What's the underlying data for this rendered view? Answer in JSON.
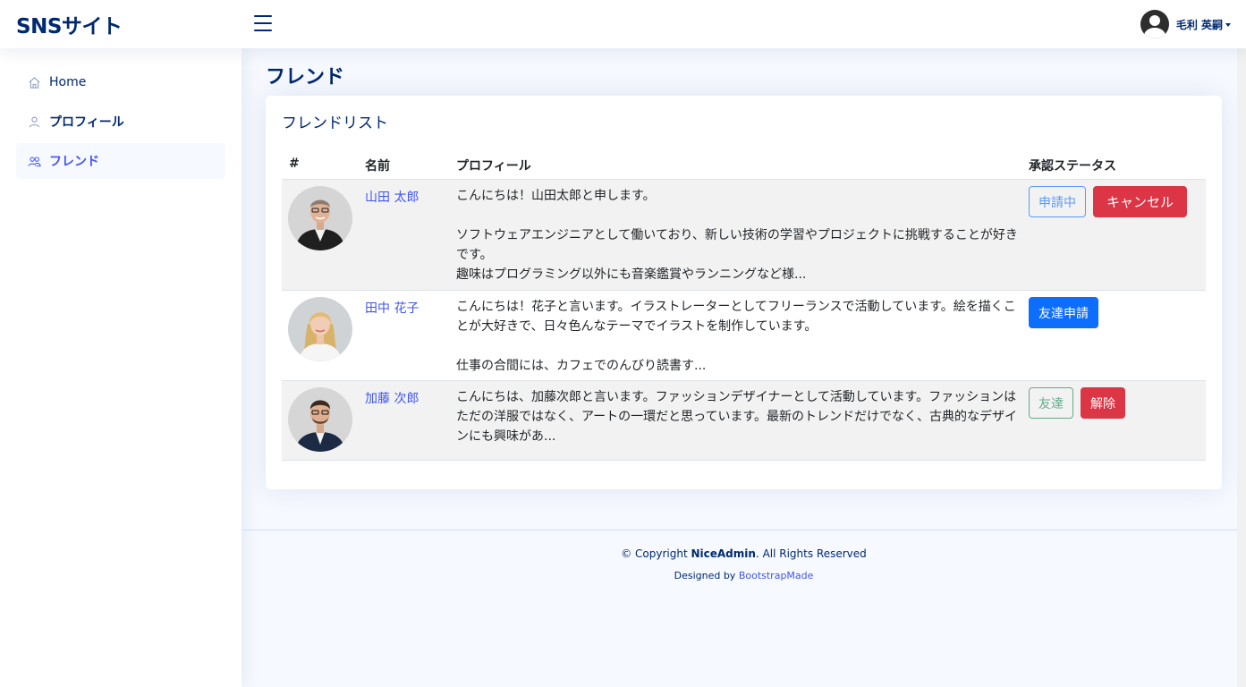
{
  "header": {
    "logo": "SNSサイト",
    "user_name": "毛利 英嗣"
  },
  "sidebar": {
    "items": [
      {
        "label": "Home",
        "icon": "house-icon"
      },
      {
        "label": "プロフィール",
        "icon": "person-icon"
      },
      {
        "label": "フレンド",
        "icon": "people-icon"
      }
    ]
  },
  "main": {
    "page_title": "フレンド",
    "card_title": "フレンドリスト",
    "columns": [
      "#",
      "名前",
      "プロフィール",
      "承認ステータス"
    ],
    "rows": [
      {
        "name": "山田 太郎",
        "profile": "こんにちは！山田太郎と申します。\n\nソフトウェアエンジニアとして働いており、新しい技術の学習やプロジェクトに挑戦することが好きです。\n趣味はプログラミング以外にも音楽鑑賞やランニングなど様...",
        "actions": [
          "申請中",
          "キャンセル"
        ]
      },
      {
        "name": "田中 花子",
        "profile": "こんにちは！花子と言います。イラストレーターとしてフリーランスで活動しています。絵を描くことが大好きで、日々色んなテーマでイラストを制作しています。\n\n仕事の合間には、カフェでのんびり読書す...",
        "actions": [
          "友達申請"
        ]
      },
      {
        "name": "加藤 次郎",
        "profile": "こんにちは、加藤次郎と言います。ファッションデザイナーとして活動しています。ファッションはただの洋服ではなく、アートの一環だと思っています。最新のトレンドだけでなく、古典的なデザインにも興味があ...",
        "actions": [
          "友達",
          "解除"
        ]
      }
    ]
  },
  "footer": {
    "copyright_prefix": "© Copyright ",
    "brand": "NiceAdmin",
    "copyright_suffix": ". All Rights Reserved",
    "designed_by": "Designed by ",
    "designer": "BootstrapMade"
  },
  "colors": {
    "primary": "#4154f1",
    "navy": "#012970",
    "danger": "#dc3545",
    "btn_primary": "#0d6efd",
    "success": "#198754"
  }
}
